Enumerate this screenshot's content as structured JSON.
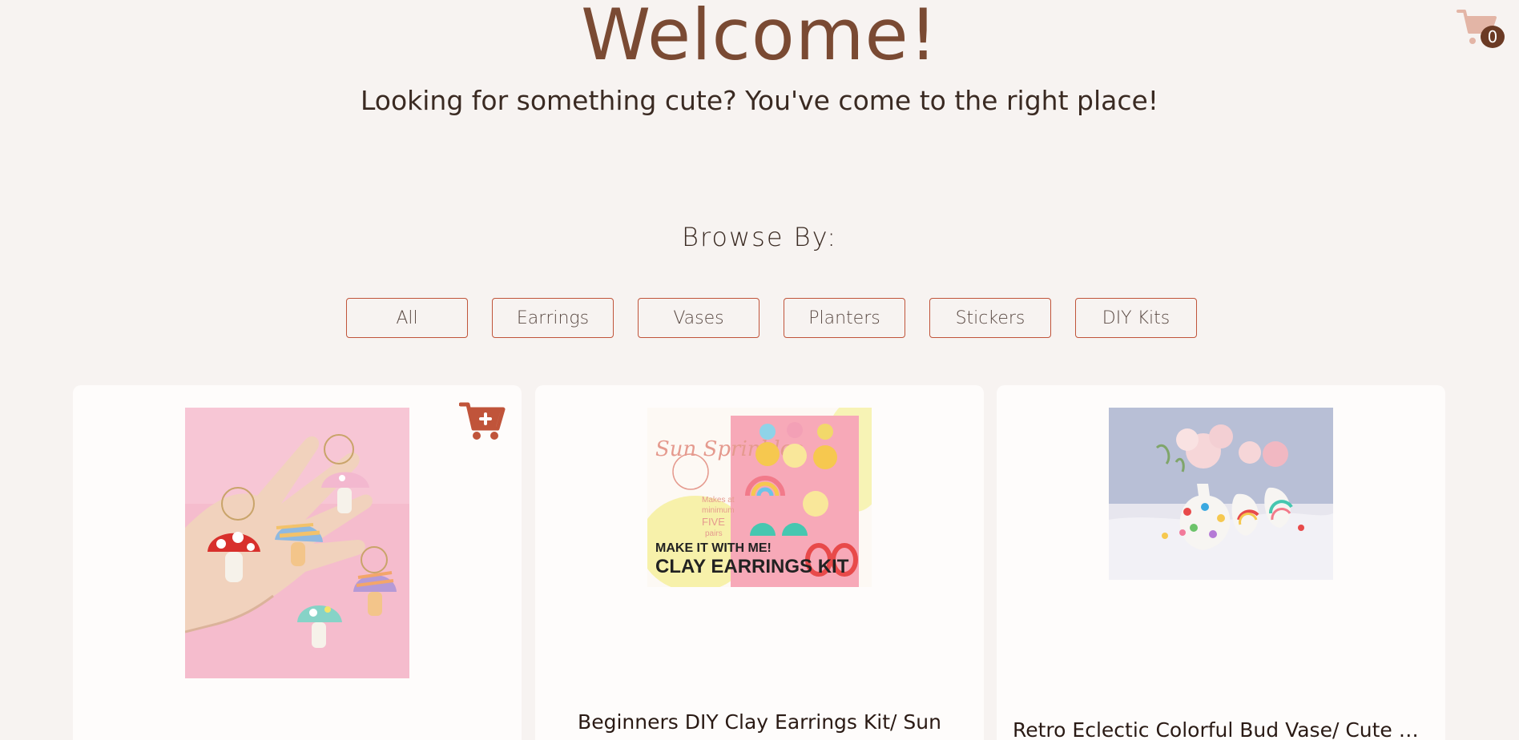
{
  "header": {
    "title": "Welcome!",
    "subtitle": "Looking for something cute? You've come to the right place!"
  },
  "cart": {
    "count": "0",
    "icon": "cart-icon"
  },
  "browse": {
    "label": "Browse By:",
    "filters": [
      "All",
      "Earrings",
      "Vases",
      "Planters",
      "Stickers",
      "DIY Kits"
    ]
  },
  "products": [
    {
      "title": "",
      "image": "mushroom-earrings-photo",
      "action_icon": "cart-plus-icon"
    },
    {
      "title": "Beginners DIY Clay Earrings Kit/ Sun",
      "image": "clay-earrings-kit-photo",
      "image_text": {
        "brand": "Sun Sprinkles",
        "note_line1": "Makes at",
        "note_line2": "minimum",
        "note_line3": "FIVE",
        "note_line4": "pairs",
        "line1": "MAKE IT WITH ME!",
        "line2": "CLAY EARRINGS KIT"
      }
    },
    {
      "title": "Retro Eclectic Colorful Bud Vase/ Cute C...",
      "image": "bud-vase-photo"
    }
  ],
  "colors": {
    "background": "#f7f3f1",
    "title": "#7a4a33",
    "accent": "#c0543a",
    "card": "#fefcfb"
  }
}
